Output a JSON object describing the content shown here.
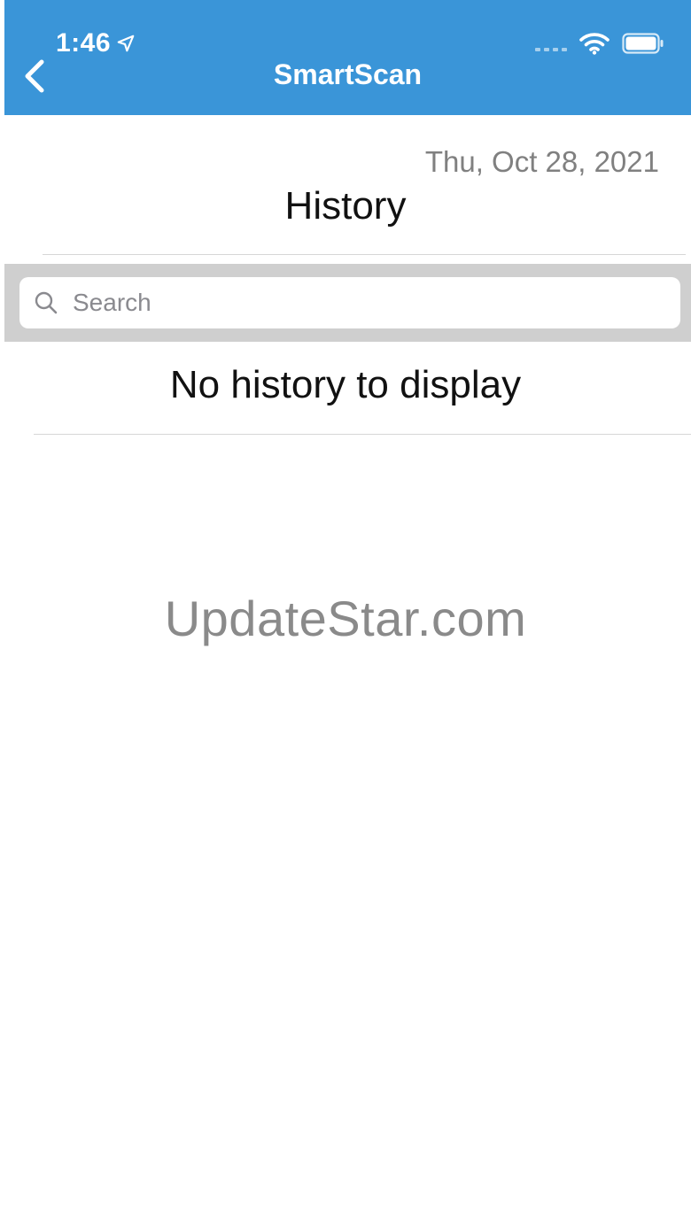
{
  "status_bar": {
    "time": "1:46",
    "icons": [
      "location-arrow-icon",
      "signal-dots-icon",
      "wifi-icon",
      "battery-icon"
    ]
  },
  "header": {
    "title": "SmartScan",
    "back_icon": "chevron-left-icon",
    "background_color": "#3a95d8"
  },
  "content": {
    "date": "Thu, Oct 28, 2021",
    "title": "History",
    "search": {
      "placeholder": "Search",
      "value": "",
      "icon": "search-icon"
    },
    "empty_message": "No history to display"
  },
  "watermark": "UpdateStar.com"
}
